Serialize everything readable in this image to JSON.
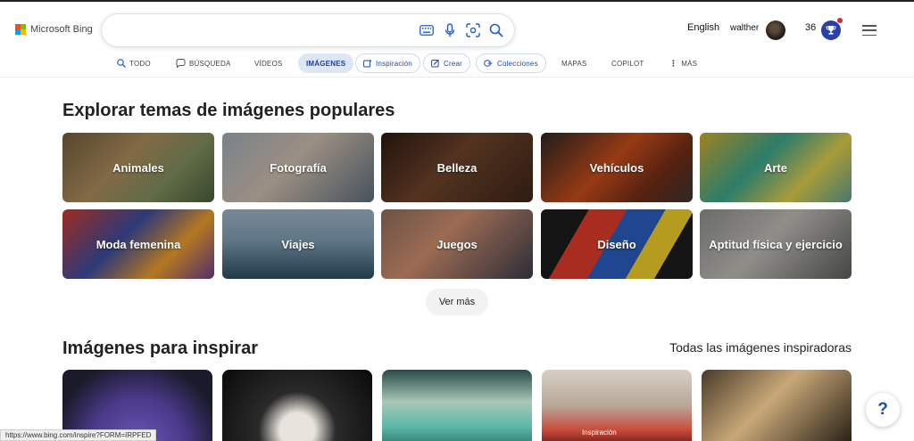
{
  "header": {
    "logo_text": "Microsoft Bing",
    "search": {
      "value": "",
      "placeholder": ""
    },
    "language": "English",
    "username": "walther",
    "reward_points": "36",
    "icons": [
      "keyboard-icon",
      "microphone-icon",
      "visual-search-icon",
      "search-icon",
      "rewards-icon",
      "hamburger-menu-icon"
    ]
  },
  "nav": {
    "todo": "TODO",
    "busqueda": "BÚSQUEDA",
    "videos": "VÍDEOS",
    "imagenes": "IMÁGENES",
    "inspiracion": "Inspiración",
    "crear": "Crear",
    "colecciones": "Colecciones",
    "mapas": "MAPAS",
    "copilot": "COPILOT",
    "mas": "MÁS"
  },
  "popular": {
    "title": "Explorar temas de imágenes populares",
    "tiles": [
      "Animales",
      "Fotografía",
      "Belleza",
      "Vehículos",
      "Arte",
      "Moda femenina",
      "Viajes",
      "Juegos",
      "Diseño",
      "Aptitud física y ejercicio"
    ],
    "see_more": "Ver más"
  },
  "inspire": {
    "title": "Imágenes para inspirar",
    "see_all": "Todas las imágenes inspiradoras",
    "hover_label": "Inspiración"
  },
  "status_bar": "https://www.bing.com/inspire?FORM=IRPFED",
  "help_label": "?",
  "colors": {
    "accent": "#1a4bb0",
    "nav_active_bg": "#dde6f7"
  }
}
